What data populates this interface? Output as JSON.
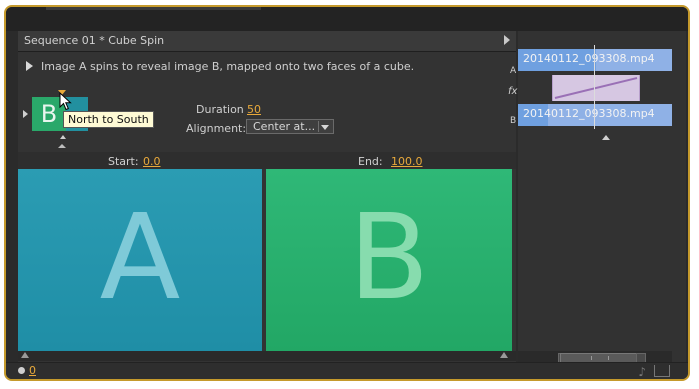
{
  "header": {
    "title": "Sequence 01 * Cube Spin"
  },
  "effect": {
    "description": "Image A spins to reveal image B, mapped onto two faces of a cube.",
    "thumbnail": {
      "letter": "B"
    },
    "tooltip": "North to South",
    "duration_label": "Duration",
    "duration_value": "50",
    "alignment_label": "Alignment:",
    "alignment_value": "Center at..."
  },
  "preview": {
    "start_label": "Start:",
    "start_value": "0.0",
    "end_label": "End:",
    "end_value": "100.0",
    "image_a_letter": "A",
    "image_b_letter": "B"
  },
  "timeline": {
    "track_a_label": "A",
    "track_fx_label": "fx",
    "track_b_label": "B",
    "clip_a_name": "20140112_093308.mp4",
    "clip_b_name": "20140112_093308.mp4"
  },
  "footer": {
    "value": "0"
  },
  "icons": [
    "play-icon",
    "panel-menu-icon",
    "direction-arrow-icon",
    "dropdown-icon",
    "audio-icon",
    "export-icon"
  ],
  "colors": {
    "accent": "#e8a93b",
    "image_a": "#2b9cb3",
    "image_b": "#2fb877",
    "clip": "#8fb1e6",
    "fx": "#d6c7e2"
  }
}
